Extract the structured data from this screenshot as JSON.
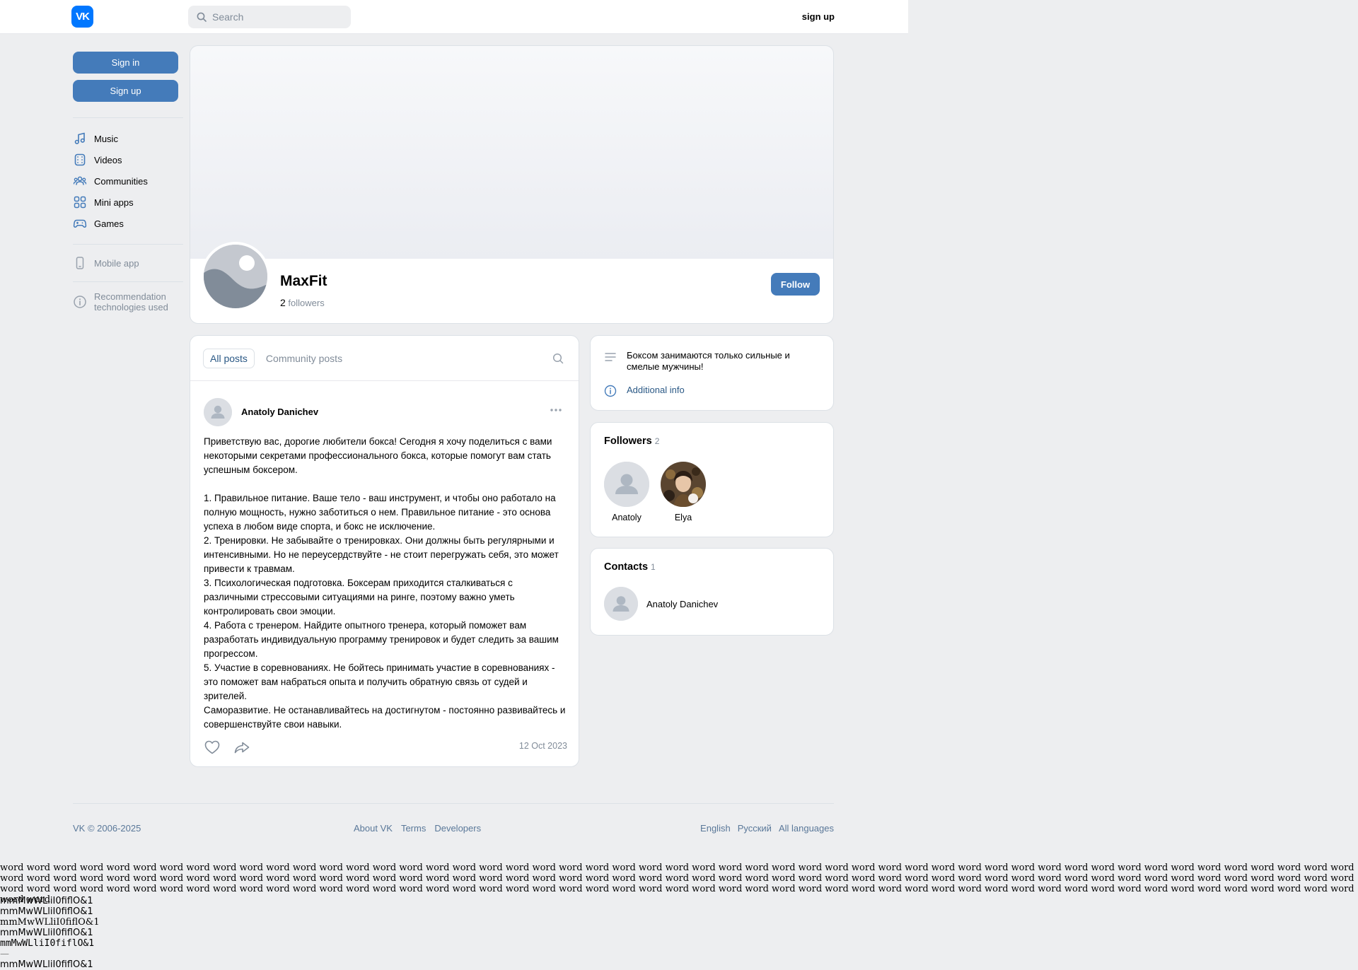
{
  "header": {
    "logo_text": "VK",
    "search_placeholder": "Search",
    "signup_link": "sign up"
  },
  "sidebar": {
    "signin_button": "Sign in",
    "signup_button": "Sign up",
    "nav": [
      {
        "label": "Music",
        "icon": "music-icon"
      },
      {
        "label": "Videos",
        "icon": "video-icon"
      },
      {
        "label": "Communities",
        "icon": "communities-icon"
      },
      {
        "label": "Mini apps",
        "icon": "mini-apps-icon"
      },
      {
        "label": "Games",
        "icon": "gamepad-icon"
      }
    ],
    "mobile_app": "Mobile app",
    "recommendation_line1": "Recommendation",
    "recommendation_line2": "technologies used"
  },
  "profile": {
    "name": "MaxFit",
    "followers_count": "2",
    "followers_label": "followers",
    "follow_button": "Follow"
  },
  "posts": {
    "tabs": [
      {
        "label": "All posts",
        "active": true
      },
      {
        "label": "Community posts",
        "active": false
      }
    ],
    "post": {
      "author": "Anatoly Danichev",
      "text": "Приветствую вас, дорогие любители бокса! Сегодня я хочу поделиться с вами некоторыми секретами профессионального бокса, которые помогут вам стать успешным боксером.\n\n1. Правильное питание. Ваше тело - ваш инструмент, и чтобы оно работало на полную мощность, нужно заботиться о нем. Правильное питание - это основа успеха в любом виде спорта, и бокс не исключение.\n2. Тренировки. Не забывайте о тренировках. Они должны быть регулярными и интенсивными. Но не переусердствуйте - не стоит перегружать себя, это может привести к травмам.\n3. Психологическая подготовка. Боксерам приходится сталкиваться с различными стрессовыми ситуациями на ринге, поэтому важно уметь контролировать свои эмоции.\n4. Работа с тренером. Найдите опытного тренера, который поможет вам разработать индивидуальную программу тренировок и будет следить за вашим прогрессом.\n5. Участие в соревнованиях. Не бойтесь принимать участие в соревнованиях - это поможет вам набраться опыта и получить обратную связь от судей и зрителей.\nСаморазвитие. Не останавливайтесь на достигнутом - постоянно развивайтесь и совершенствуйте свои навыки.",
      "date": "12 Oct 2023"
    }
  },
  "info": {
    "description": "Боксом занимаются только сильные и смелые мужчины!",
    "additional": "Additional info"
  },
  "followers": {
    "title": "Followers",
    "count": "2",
    "items": [
      {
        "name": "Anatoly"
      },
      {
        "name": "Elya"
      }
    ]
  },
  "contacts": {
    "title": "Contacts",
    "count": "1",
    "items": [
      {
        "name": "Anatoly Danichev"
      }
    ]
  },
  "footer": {
    "copyright": "VK © 2006-2025",
    "about": "About VK",
    "terms": "Terms",
    "developers": "Developers",
    "english": "English",
    "russian": "Русский",
    "all_languages": "All languages"
  },
  "font_test": {
    "words": "word word word word word word word word word word word word word word word word word word word word word word word word word word word word word word word word word word word word word word word word word word word word word word word word word word word word word word word word word word word word word word word word word word word word word word word word word word word word word word word word word word word word word word word word word word word word word word word word word word word word word word word word word word word word word word word word word word word word word word word word word word word word word word word word word word word word word word word word word word word word word word word word word word word word word word word word word word word",
    "samples": [
      "mmMwWLliI0fiflO&1",
      "mmMwWLliI0fiflO&1",
      "mmMwWLliI0fiflO&1",
      "mmMwWLliI0fiflO&1",
      "mmMwWLliI0fiflO&1",
      "mmMwWLliI0fiflO&1"
    ],
    "dash": "—"
  }
}
